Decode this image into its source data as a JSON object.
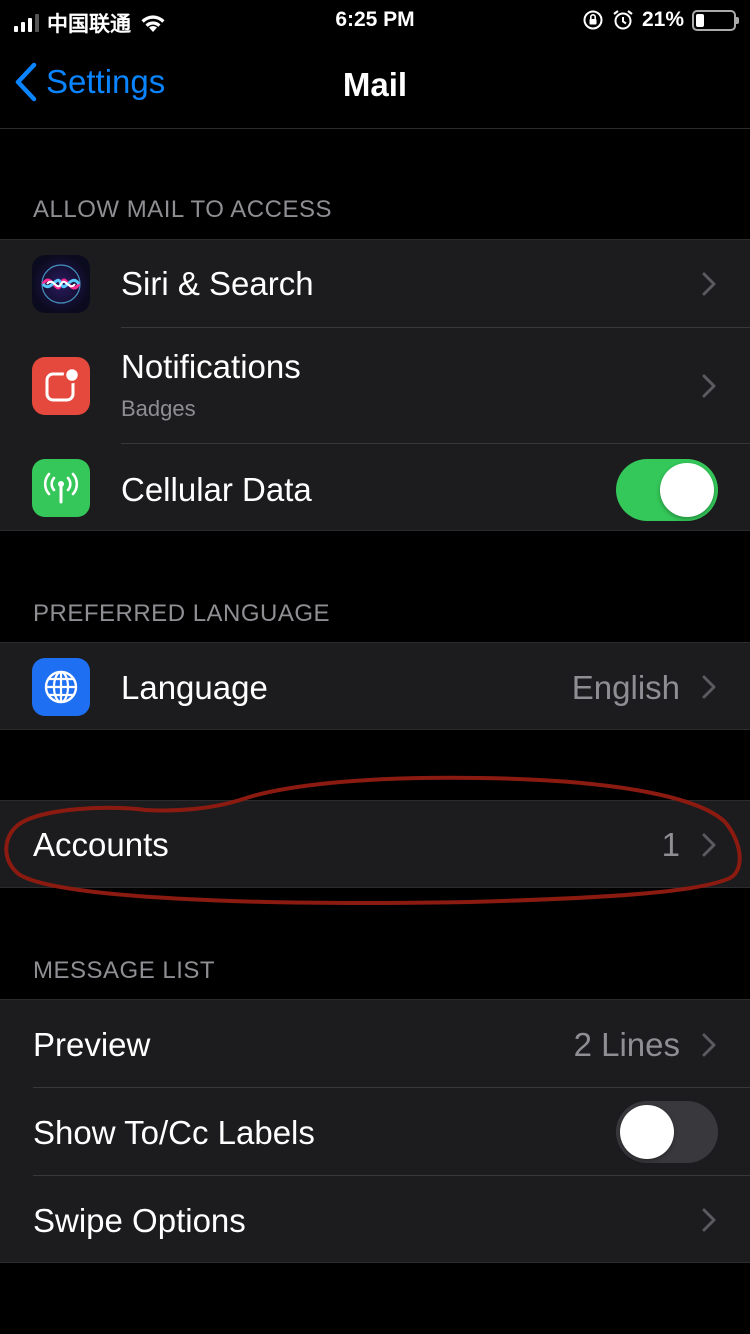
{
  "status_bar": {
    "carrier": "中国联通",
    "time": "6:25 PM",
    "battery_percent": "21%"
  },
  "nav": {
    "back_label": "Settings",
    "title": "Mail"
  },
  "allow_access": {
    "header": "ALLOW MAIL TO ACCESS",
    "siri": {
      "label": "Siri & Search"
    },
    "notifications": {
      "label": "Notifications",
      "sublabel": "Badges"
    },
    "cellular": {
      "label": "Cellular Data",
      "enabled": true
    }
  },
  "preferred_language": {
    "header": "PREFERRED LANGUAGE",
    "language": {
      "label": "Language",
      "value": "English"
    }
  },
  "accounts": {
    "label": "Accounts",
    "value": "1"
  },
  "message_list": {
    "header": "MESSAGE LIST",
    "preview": {
      "label": "Preview",
      "value": "2 Lines"
    },
    "show_to_cc": {
      "label": "Show To/Cc Labels",
      "enabled": false
    },
    "swipe_options": {
      "label": "Swipe Options"
    }
  },
  "colors": {
    "accent": "#0a84ff",
    "toggle_on": "#34c759",
    "annotation": "#8b1a10"
  }
}
